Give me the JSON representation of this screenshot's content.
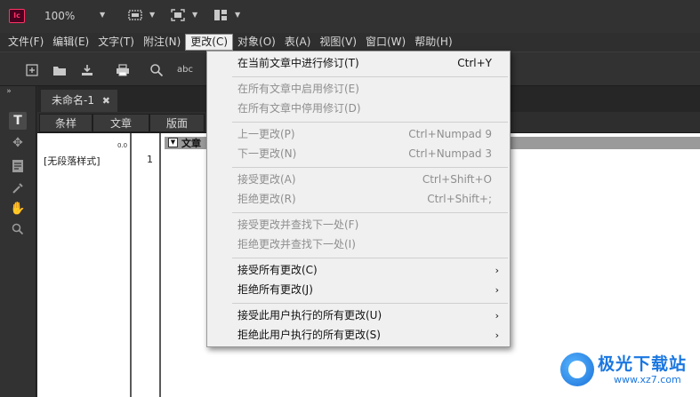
{
  "titlebar": {
    "app_icon_text": "Ic",
    "zoom": "100%"
  },
  "menubar": {
    "items": [
      {
        "label": "文件(F)"
      },
      {
        "label": "编辑(E)"
      },
      {
        "label": "文字(T)"
      },
      {
        "label": "附注(N)"
      },
      {
        "label": "更改(C)"
      },
      {
        "label": "对象(O)"
      },
      {
        "label": "表(A)"
      },
      {
        "label": "视图(V)"
      },
      {
        "label": "窗口(W)"
      },
      {
        "label": "帮助(H)"
      }
    ]
  },
  "toolbar": {
    "spell_label": "abc"
  },
  "document": {
    "tab_title": "未命名-1",
    "close_glyph": "✖",
    "subtabs": [
      "条样",
      "文章",
      "版面"
    ],
    "paragraph_style": "[无段落样式]",
    "line_number": "1",
    "ruler_value": "0.0",
    "story_label": "文章"
  },
  "dropdown": {
    "items": [
      {
        "label": "在当前文章中进行修订(T)",
        "shortcut": "Ctrl+Y",
        "disabled": false
      },
      {
        "label": "在所有文章中启用修订(E)",
        "shortcut": "",
        "disabled": true
      },
      {
        "label": "在所有文章中停用修订(D)",
        "shortcut": "",
        "disabled": true
      },
      {
        "label": "上一更改(P)",
        "shortcut": "Ctrl+Numpad 9",
        "disabled": true
      },
      {
        "label": "下一更改(N)",
        "shortcut": "Ctrl+Numpad 3",
        "disabled": true
      },
      {
        "label": "接受更改(A)",
        "shortcut": "Ctrl+Shift+O",
        "disabled": true
      },
      {
        "label": "拒绝更改(R)",
        "shortcut": "Ctrl+Shift+;",
        "disabled": true
      },
      {
        "label": "接受更改并查找下一处(F)",
        "shortcut": "",
        "disabled": true
      },
      {
        "label": "拒绝更改并查找下一处(I)",
        "shortcut": "",
        "disabled": true
      },
      {
        "label": "接受所有更改(C)",
        "shortcut": "",
        "disabled": false
      },
      {
        "label": "拒绝所有更改(J)",
        "shortcut": "",
        "disabled": false
      },
      {
        "label": "接受此用户执行的所有更改(U)",
        "shortcut": "",
        "disabled": false
      },
      {
        "label": "拒绝此用户执行的所有更改(S)",
        "shortcut": "",
        "disabled": false
      }
    ],
    "submenu_arrow": "›"
  },
  "watermark": {
    "title": "极光下载站",
    "url": "www.xz7.com"
  },
  "colors": {
    "app_icon": "#ff3366",
    "menu_bg": "#f0f0f0",
    "watermark": "#1a77e0"
  }
}
